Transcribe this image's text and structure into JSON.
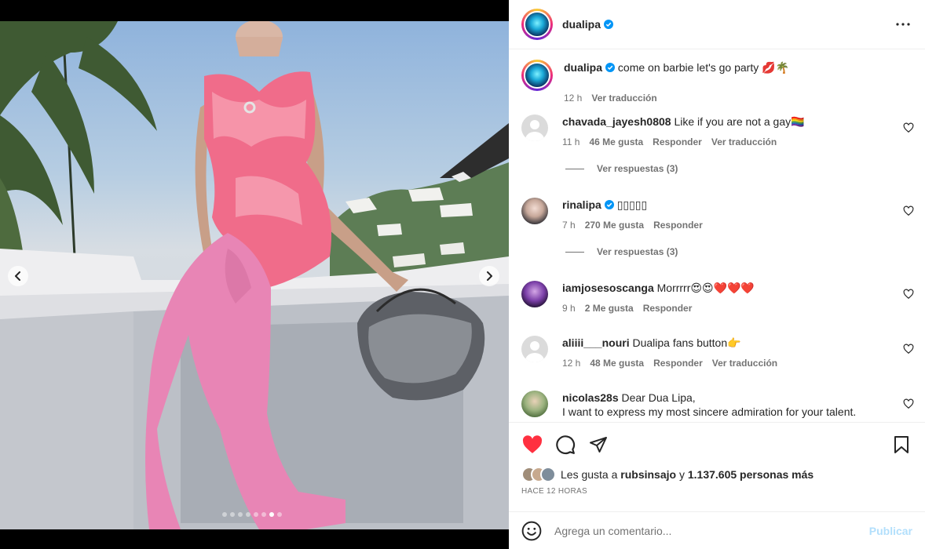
{
  "post": {
    "author": "dualipa",
    "verified": true,
    "caption_text": "come on barbie let's go party 💋🌴",
    "caption_time": "12 h",
    "caption_translate": "Ver traducción"
  },
  "media": {
    "image_count": 8,
    "active_index": 6,
    "prev_icon": "chevron-left-icon",
    "next_icon": "chevron-right-icon"
  },
  "comments": [
    {
      "user": "chavada_jayesh0808",
      "text": "Like if you are not a gay🏳️‍🌈",
      "time": "11 h",
      "likes": "46 Me gusta",
      "reply": "Responder",
      "translate": "Ver traducción",
      "replies": "Ver respuestas (3)"
    },
    {
      "user": "rinalipa",
      "verified": true,
      "text": "▯▯▯▯▯",
      "time": "7 h",
      "likes": "270 Me gusta",
      "reply": "Responder",
      "replies": "Ver respuestas (3)"
    },
    {
      "user": "iamjosesoscanga",
      "text": "Morrrrr😍😍❤️❤️❤️",
      "time": "9 h",
      "likes": "2 Me gusta",
      "reply": "Responder"
    },
    {
      "user": "aliiii___nouri",
      "text": "Dualipa fans button👉",
      "time": "12 h",
      "likes": "48 Me gusta",
      "reply": "Responder",
      "translate": "Ver traducción"
    },
    {
      "user": "nicolas28s",
      "text": "Dear Dua Lipa,",
      "text2": "I want to express my most sincere admiration for your talent."
    }
  ],
  "actions": {
    "like_icon": "heart-filled-icon",
    "comment_icon": "comment-icon",
    "share_icon": "share-icon",
    "save_icon": "bookmark-icon",
    "like_color": "#ff3040"
  },
  "likes": {
    "prefix": "Les gusta a",
    "user": "rubsinsajo",
    "connector": "y",
    "count": "1.137.605 personas más"
  },
  "timestamp": "HACE 12 HORAS",
  "add_comment": {
    "placeholder": "Agrega un comentario...",
    "publish": "Publicar"
  }
}
